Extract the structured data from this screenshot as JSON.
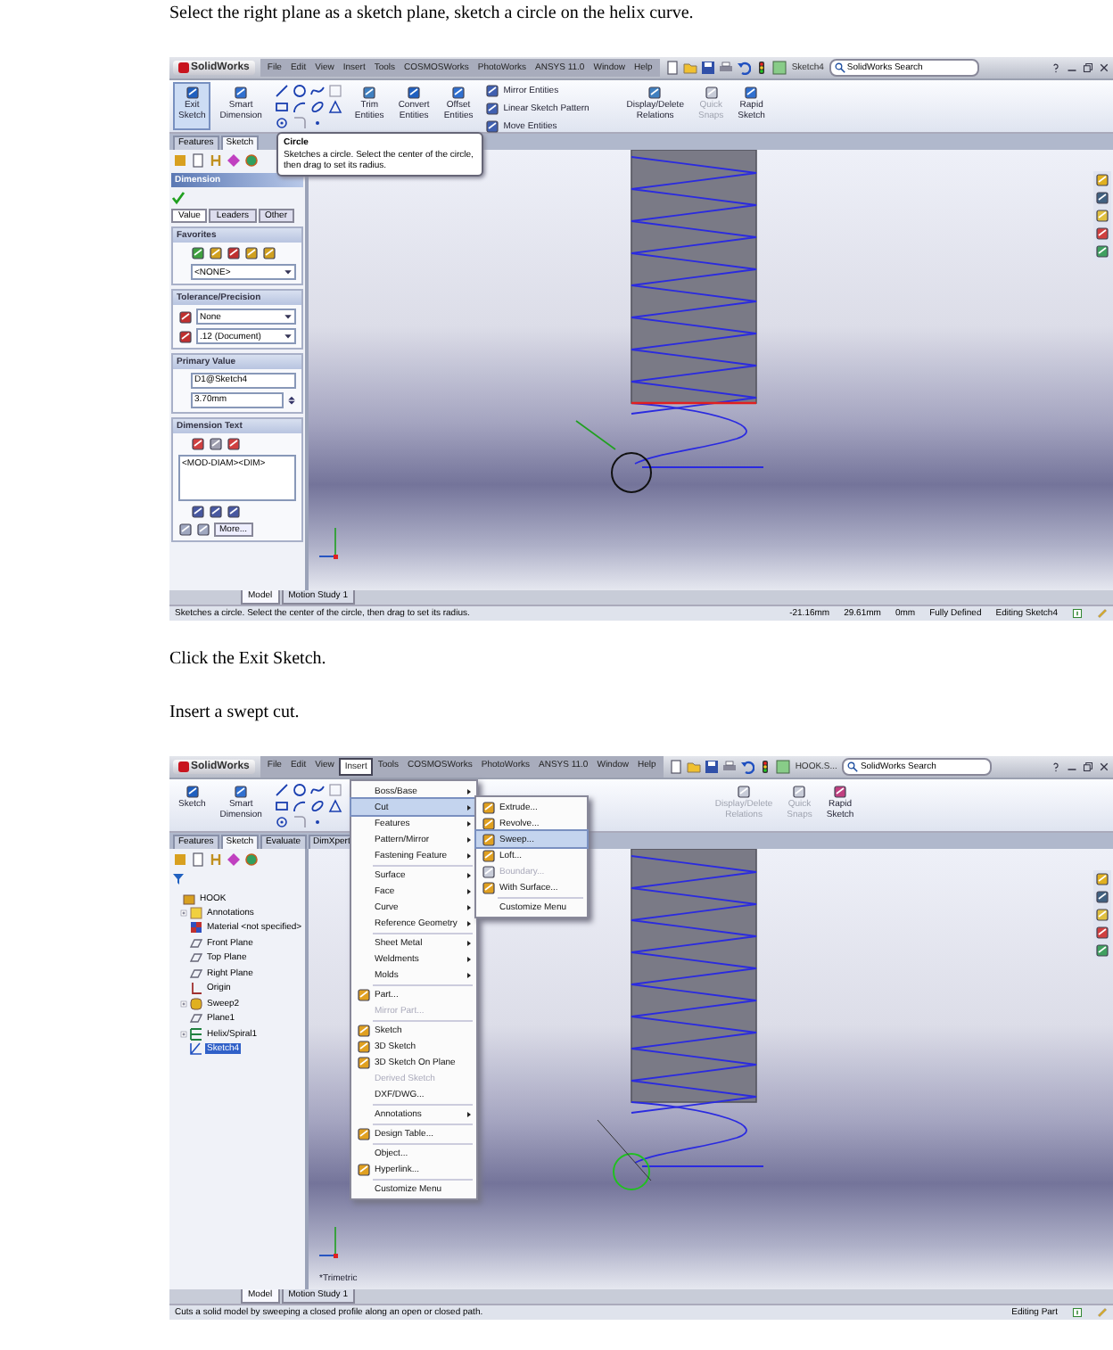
{
  "content": [
    {
      "kind": "text",
      "text": "Select the right plane as a sketch plane, sketch a circle on the helix curve."
    },
    {
      "kind": "screenshot",
      "title_bar": {
        "logo": "SolidWorks",
        "menus": [
          {
            "label": "File",
            "selected": false
          },
          {
            "label": "Edit",
            "selected": false
          },
          {
            "label": "View",
            "selected": false
          },
          {
            "label": "Insert",
            "selected": false
          },
          {
            "label": "Tools",
            "selected": false
          },
          {
            "label": "COSMOSWorks",
            "selected": false
          },
          {
            "label": "PhotoWorks",
            "selected": false
          },
          {
            "label": "ANSYS 11.0",
            "selected": false
          },
          {
            "label": "Window",
            "selected": false
          },
          {
            "label": "Help",
            "selected": false
          }
        ],
        "document": "Sketch4",
        "search": "SolidWorks Search"
      },
      "ribbon": [
        {
          "kind": "large",
          "label": "Exit Sketch",
          "selected": true,
          "disabled": false
        },
        {
          "kind": "large",
          "label": "Smart Dimension",
          "selected": false,
          "disabled": false
        },
        {
          "kind": "cluster"
        },
        {
          "kind": "large",
          "label": "Trim Entities",
          "selected": false,
          "disabled": false
        },
        {
          "kind": "large",
          "label": "Convert Entities",
          "selected": false,
          "disabled": false
        },
        {
          "kind": "large",
          "label": "Offset Entities",
          "selected": false,
          "disabled": false
        },
        {
          "kind": "list",
          "items": [
            "Mirror Entities",
            "Linear Sketch Pattern",
            "Move Entities"
          ]
        },
        {
          "kind": "large",
          "label": "Display/Delete Relations",
          "selected": false,
          "disabled": false
        },
        {
          "kind": "large",
          "label": "Quick Snaps",
          "selected": false,
          "disabled": true
        },
        {
          "kind": "large",
          "label": "Rapid Sketch",
          "selected": false,
          "disabled": false
        }
      ],
      "tabs": [
        {
          "label": "Features",
          "selected": false
        },
        {
          "label": "Sketch",
          "selected": true
        }
      ],
      "tooltip": {
        "title": "Circle",
        "text": "Sketches a circle. Select the center of the circle, then drag to set its radius."
      },
      "panel": {
        "kind": "property",
        "title": "Dimension",
        "tabs": [
          {
            "label": "Value",
            "selected": true
          },
          {
            "label": "Leaders",
            "selected": false
          },
          {
            "label": "Other",
            "selected": false
          }
        ],
        "groups": [
          {
            "title": "Favorites",
            "rows": [
              {
                "kind": "favorite-icons"
              },
              {
                "kind": "dropdown",
                "value": "<NONE>"
              }
            ]
          },
          {
            "title": "Tolerance/Precision",
            "rows": [
              {
                "kind": "icon-dropdown",
                "value": "None"
              },
              {
                "kind": "icon-dropdown",
                "value": ".12 (Document)"
              }
            ]
          },
          {
            "title": "Primary Value",
            "rows": [
              {
                "kind": "field",
                "value": "D1@Sketch4"
              },
              {
                "kind": "spin",
                "value": "3.70mm"
              }
            ]
          },
          {
            "title": "Dimension Text",
            "rows": [
              {
                "kind": "text-icons"
              },
              {
                "kind": "textarea",
                "value": "<MOD-DIAM><DIM>"
              },
              {
                "kind": "align-icons"
              },
              {
                "kind": "button",
                "value": "More..."
              }
            ]
          }
        ]
      },
      "view": {
        "kind": "sketch"
      },
      "bottom_tabs": [
        {
          "label": "Model",
          "selected": true
        },
        {
          "label": "Motion Study 1",
          "selected": false
        }
      ],
      "status": [
        "Sketches a circle. Select the center of the circle, then drag to set its radius.",
        "-21.16mm",
        "29.61mm",
        "0mm",
        "Fully Defined",
        "Editing Sketch4"
      ]
    },
    {
      "kind": "text",
      "text": "Click the Exit Sketch."
    },
    {
      "kind": "text",
      "text": "Insert a swept cut."
    },
    {
      "kind": "screenshot",
      "title_bar": {
        "logo": "SolidWorks",
        "menus": [
          {
            "label": "File",
            "selected": false
          },
          {
            "label": "Edit",
            "selected": false
          },
          {
            "label": "View",
            "selected": false
          },
          {
            "label": "Insert",
            "selected": true
          },
          {
            "label": "Tools",
            "selected": false
          },
          {
            "label": "COSMOSWorks",
            "selected": false
          },
          {
            "label": "PhotoWorks",
            "selected": false
          },
          {
            "label": "ANSYS 11.0",
            "selected": false
          },
          {
            "label": "Window",
            "selected": false
          },
          {
            "label": "Help",
            "selected": false
          }
        ],
        "document": "HOOK.S...",
        "search": "SolidWorks Search"
      },
      "ribbon": [
        {
          "kind": "large",
          "label": "Sketch",
          "selected": false,
          "disabled": false
        },
        {
          "kind": "large",
          "label": "Smart Dimension",
          "selected": false,
          "disabled": false
        },
        {
          "kind": "cluster"
        },
        {
          "kind": "spacer"
        },
        {
          "kind": "large",
          "label": "Display/Delete Relations",
          "selected": false,
          "disabled": true
        },
        {
          "kind": "large",
          "label": "Quick Snaps",
          "selected": false,
          "disabled": true
        },
        {
          "kind": "large",
          "label": "Rapid Sketch",
          "selected": false,
          "disabled": false
        }
      ],
      "tabs": [
        {
          "label": "Features",
          "selected": false
        },
        {
          "label": "Sketch",
          "selected": true
        },
        {
          "label": "Evaluate",
          "selected": false
        },
        {
          "label": "DimXpert",
          "selected": false
        }
      ],
      "menu": {
        "items": [
          {
            "kind": "item",
            "label": "Boss/Base",
            "submenu": true,
            "disabled": false,
            "selected": false,
            "icon": false
          },
          {
            "kind": "item",
            "label": "Cut",
            "submenu": true,
            "disabled": false,
            "selected": true,
            "icon": false
          },
          {
            "kind": "item",
            "label": "Features",
            "submenu": true,
            "disabled": false,
            "selected": false,
            "icon": false
          },
          {
            "kind": "item",
            "label": "Pattern/Mirror",
            "submenu": true,
            "disabled": false,
            "selected": false,
            "icon": false
          },
          {
            "kind": "item",
            "label": "Fastening Feature",
            "submenu": true,
            "disabled": false,
            "selected": false,
            "icon": false
          },
          {
            "kind": "separator"
          },
          {
            "kind": "item",
            "label": "Surface",
            "submenu": true,
            "disabled": false,
            "selected": false,
            "icon": false
          },
          {
            "kind": "item",
            "label": "Face",
            "submenu": true,
            "disabled": false,
            "selected": false,
            "icon": false
          },
          {
            "kind": "item",
            "label": "Curve",
            "submenu": true,
            "disabled": false,
            "selected": false,
            "icon": false
          },
          {
            "kind": "item",
            "label": "Reference Geometry",
            "submenu": true,
            "disabled": false,
            "selected": false,
            "icon": false
          },
          {
            "kind": "separator"
          },
          {
            "kind": "item",
            "label": "Sheet Metal",
            "submenu": true,
            "disabled": false,
            "selected": false,
            "icon": false
          },
          {
            "kind": "item",
            "label": "Weldments",
            "submenu": true,
            "disabled": false,
            "selected": false,
            "icon": false
          },
          {
            "kind": "item",
            "label": "Molds",
            "submenu": true,
            "disabled": false,
            "selected": false,
            "icon": false
          },
          {
            "kind": "separator"
          },
          {
            "kind": "item",
            "label": "Part...",
            "submenu": false,
            "disabled": false,
            "selected": false,
            "icon": true
          },
          {
            "kind": "item",
            "label": "Mirror Part...",
            "submenu": false,
            "disabled": true,
            "selected": false,
            "icon": false
          },
          {
            "kind": "separator"
          },
          {
            "kind": "item",
            "label": "Sketch",
            "submenu": false,
            "disabled": false,
            "selected": false,
            "icon": true
          },
          {
            "kind": "item",
            "label": "3D Sketch",
            "submenu": false,
            "disabled": false,
            "selected": false,
            "icon": true
          },
          {
            "kind": "item",
            "label": "3D Sketch On Plane",
            "submenu": false,
            "disabled": false,
            "selected": false,
            "icon": true
          },
          {
            "kind": "item",
            "label": "Derived Sketch",
            "submenu": false,
            "disabled": true,
            "selected": false,
            "icon": false
          },
          {
            "kind": "item",
            "label": "DXF/DWG...",
            "submenu": false,
            "disabled": false,
            "selected": false,
            "icon": false
          },
          {
            "kind": "separator"
          },
          {
            "kind": "item",
            "label": "Annotations",
            "submenu": true,
            "disabled": false,
            "selected": false,
            "icon": false
          },
          {
            "kind": "separator"
          },
          {
            "kind": "item",
            "label": "Design Table...",
            "submenu": false,
            "disabled": false,
            "selected": false,
            "icon": true
          },
          {
            "kind": "separator"
          },
          {
            "kind": "item",
            "label": "Object...",
            "submenu": false,
            "disabled": false,
            "selected": false,
            "icon": false
          },
          {
            "kind": "item",
            "label": "Hyperlink...",
            "submenu": false,
            "disabled": false,
            "selected": false,
            "icon": true
          },
          {
            "kind": "separator"
          },
          {
            "kind": "item",
            "label": "Customize Menu",
            "submenu": false,
            "disabled": false,
            "selected": false,
            "icon": false
          }
        ],
        "submenu": [
          {
            "kind": "item",
            "label": "Extrude...",
            "submenu": false,
            "disabled": false,
            "selected": false,
            "icon": true
          },
          {
            "kind": "item",
            "label": "Revolve...",
            "submenu": false,
            "disabled": false,
            "selected": false,
            "icon": true
          },
          {
            "kind": "item",
            "label": "Sweep...",
            "submenu": false,
            "disabled": false,
            "selected": true,
            "icon": true
          },
          {
            "kind": "item",
            "label": "Loft...",
            "submenu": false,
            "disabled": false,
            "selected": false,
            "icon": true
          },
          {
            "kind": "item",
            "label": "Boundary...",
            "submenu": false,
            "disabled": true,
            "selected": false,
            "icon": true
          },
          {
            "kind": "item",
            "label": "With Surface...",
            "submenu": false,
            "disabled": false,
            "selected": false,
            "icon": true
          },
          {
            "kind": "separator"
          },
          {
            "kind": "item",
            "label": "Customize Menu",
            "submenu": false,
            "disabled": false,
            "selected": false,
            "icon": false
          }
        ]
      },
      "panel": {
        "kind": "tree",
        "tree": [
          {
            "label": "HOOK",
            "kind": "part",
            "selected": false,
            "collapsed": false,
            "children": [
              {
                "label": "Annotations",
                "kind": "annotations",
                "selected": false,
                "collapsed": true
              },
              {
                "label": "Material <not specified>",
                "kind": "material",
                "selected": false,
                "collapsed": false
              },
              {
                "label": "Front Plane",
                "kind": "plane",
                "selected": false,
                "collapsed": false
              },
              {
                "label": "Top Plane",
                "kind": "plane",
                "selected": false,
                "collapsed": false
              },
              {
                "label": "Right Plane",
                "kind": "plane",
                "selected": false,
                "collapsed": false
              },
              {
                "label": "Origin",
                "kind": "origin",
                "selected": false,
                "collapsed": false
              },
              {
                "label": "Sweep2",
                "kind": "feature",
                "selected": false,
                "collapsed": true
              },
              {
                "label": "Plane1",
                "kind": "plane",
                "selected": false,
                "collapsed": false
              },
              {
                "label": "Helix/Spiral1",
                "kind": "helix",
                "selected": false,
                "collapsed": true
              },
              {
                "label": "Sketch4",
                "kind": "sketch",
                "selected": true,
                "collapsed": false
              }
            ]
          }
        ]
      },
      "view": {
        "kind": "part",
        "label": "*Trimetric"
      },
      "bottom_tabs": [
        {
          "label": "Model",
          "selected": true
        },
        {
          "label": "Motion Study 1",
          "selected": false
        }
      ],
      "status": [
        "Cuts a solid model by sweeping a closed profile along an open or closed path.",
        "Editing Part"
      ]
    }
  ]
}
